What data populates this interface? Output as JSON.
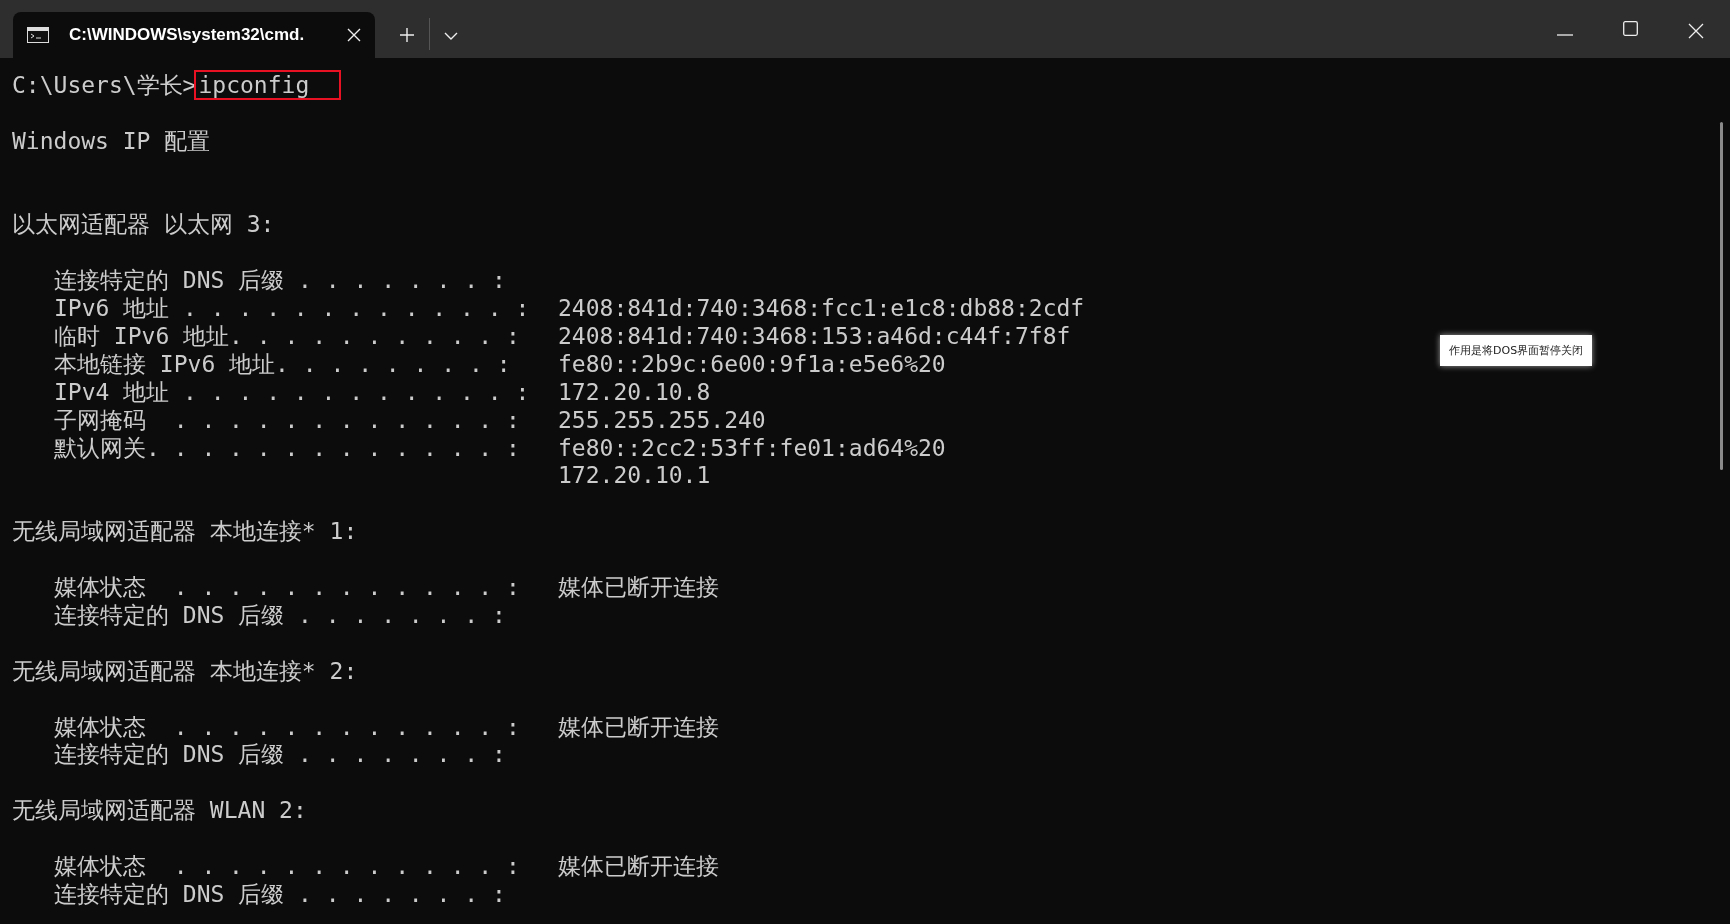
{
  "tab": {
    "title": "C:\\WINDOWS\\system32\\cmd.",
    "selected": true
  },
  "terminal": {
    "blocks": [
      {
        "kind": "prompt",
        "prompt": "C:\\Users\\学长>",
        "command": "ipconfig"
      },
      {
        "kind": "title",
        "text": "Windows IP 配置"
      },
      {
        "kind": "heading",
        "text": "以太网适配器 以太网 3:"
      },
      {
        "kind": "entries",
        "entries": [
          {
            "label": "连接特定的 DNS 后缀 . . . . . . . :"
          },
          {
            "label": "IPv6 地址 . . . . . . . . . . . . :",
            "value": "2408:841d:740:3468:fcc1:e1c8:db88:2cdf"
          },
          {
            "label": "临时 IPv6 地址. . . . . . . . . . :",
            "value": "2408:841d:740:3468:153:a46d:c44f:7f8f"
          },
          {
            "label": "本地链接 IPv6 地址. . . . . . . . :",
            "value": "fe80::2b9c:6e00:9f1a:e5e6%20"
          },
          {
            "label": "IPv4 地址 . . . . . . . . . . . . :",
            "value": "172.20.10.8"
          },
          {
            "label": "子网掩码  . . . . . . . . . . . . :",
            "value": "255.255.255.240"
          },
          {
            "label": "默认网关. . . . . . . . . . . . . :",
            "value": "fe80::2cc2:53ff:fe01:ad64%20"
          },
          {
            "value": "172.20.10.1"
          }
        ]
      },
      {
        "kind": "heading",
        "text": "无线局域网适配器 本地连接* 1:"
      },
      {
        "kind": "entries",
        "entries": [
          {
            "label": "媒体状态  . . . . . . . . . . . . :",
            "value": "媒体已断开连接"
          },
          {
            "label": "连接特定的 DNS 后缀 . . . . . . . :"
          }
        ]
      },
      {
        "kind": "heading",
        "text": "无线局域网适配器 本地连接* 2:"
      },
      {
        "kind": "entries",
        "entries": [
          {
            "label": "媒体状态  . . . . . . . . . . . . :",
            "value": "媒体已断开连接"
          },
          {
            "label": "连接特定的 DNS 后缀 . . . . . . . :"
          }
        ]
      },
      {
        "kind": "heading",
        "text": "无线局域网适配器 WLAN 2:"
      },
      {
        "kind": "entries",
        "entries": [
          {
            "label": "媒体状态  . . . . . . . . . . . . :",
            "value": "媒体已断开连接"
          },
          {
            "label": "连接特定的 DNS 后缀 . . . . . . . :"
          }
        ]
      }
    ]
  },
  "tooltip": {
    "text": "作用是将DOS界面暂停关闭"
  }
}
